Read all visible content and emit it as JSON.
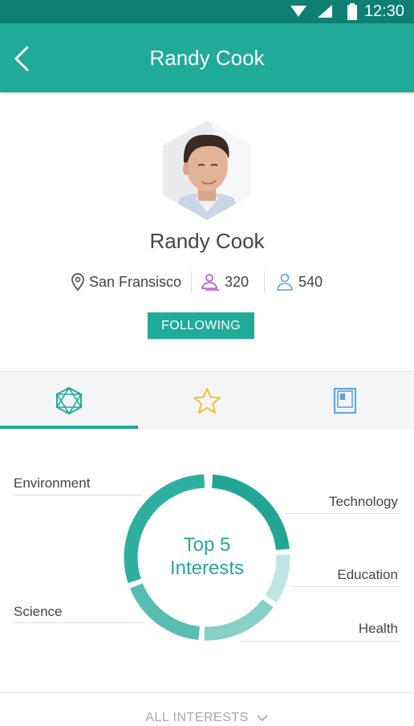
{
  "status_bar": {
    "time": "12:30"
  },
  "header": {
    "title": "Randy Cook"
  },
  "profile": {
    "name": "Randy Cook",
    "location": "San Fransisco",
    "followers_count": "320",
    "following_count": "540",
    "follow_button_label": "FOLLOWING"
  },
  "tabs": [
    {
      "icon": "hexagon-network-icon",
      "active": true
    },
    {
      "icon": "star-icon",
      "active": false
    },
    {
      "icon": "book-icon",
      "active": false
    }
  ],
  "interests": {
    "center_label_line1": "Top 5",
    "center_label_line2": "Interests",
    "items": [
      "Environment",
      "Technology",
      "Education",
      "Health",
      "Science"
    ]
  },
  "footer": {
    "all_interests_label": "ALL INTERESTS"
  },
  "colors": {
    "primary": "#20aa9a",
    "status_bar": "#0e7f73",
    "accent_purple": "#b04fc8",
    "accent_blue": "#5aa3e0",
    "star": "#f2c12e"
  }
}
